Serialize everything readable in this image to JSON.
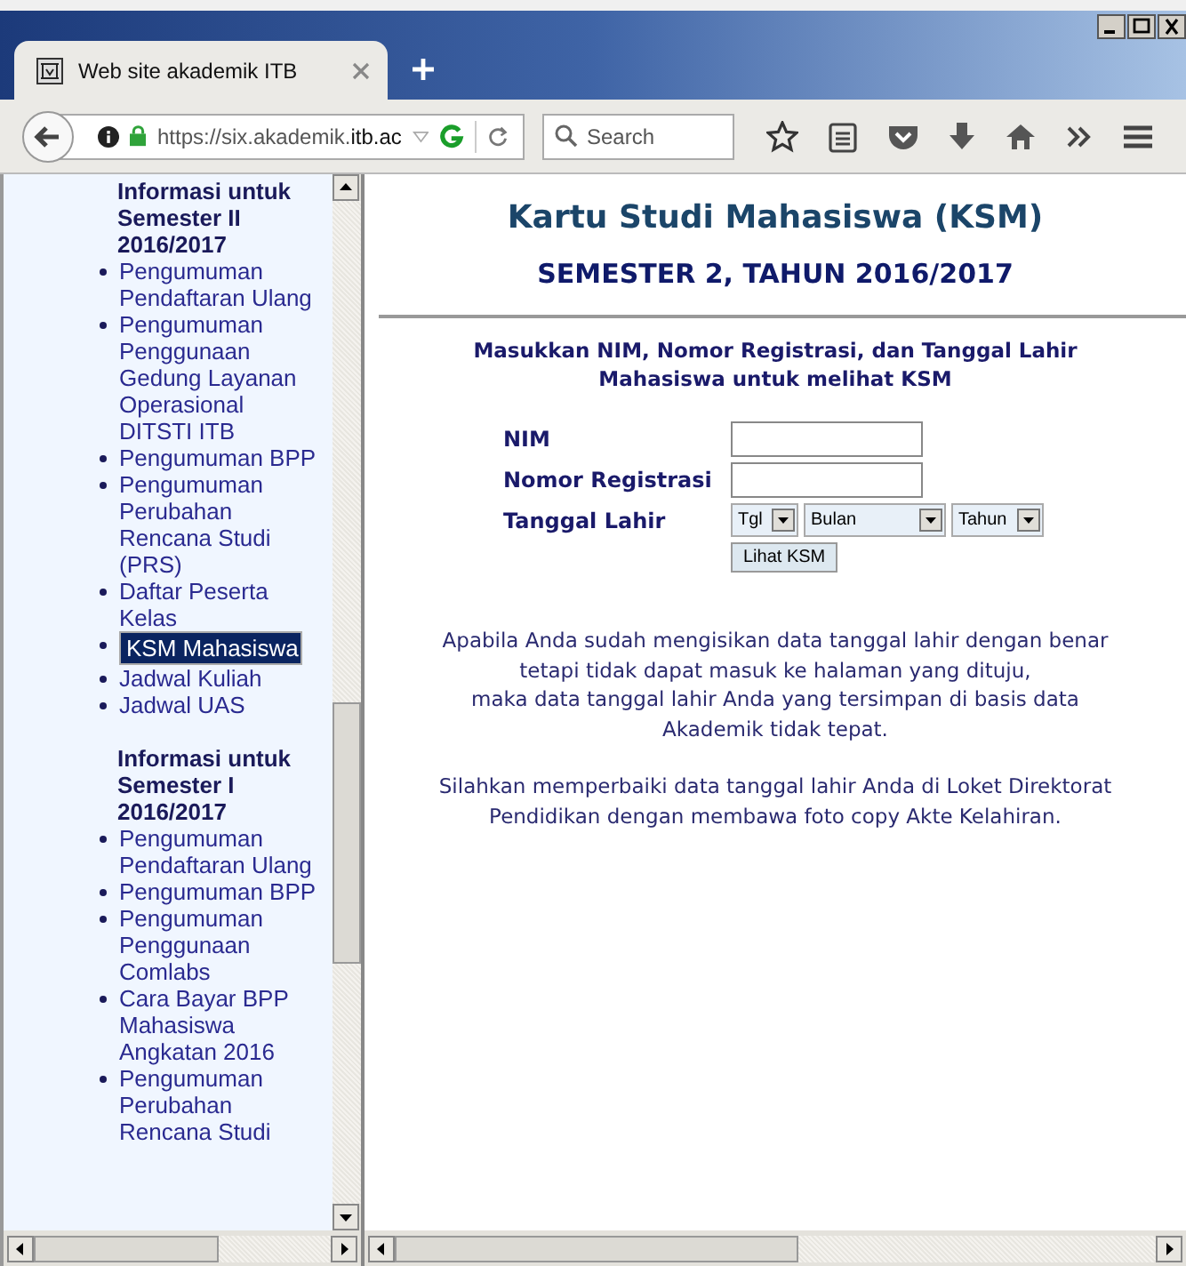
{
  "window": {
    "tab_title": "Web site akademik ITB",
    "address": "https://six.akademik.**itb.ac**",
    "search_placeholder": "Search"
  },
  "sidebar": {
    "sections": [
      {
        "heading": "Informasi untuk Semester II 2016/2017",
        "items": [
          {
            "label": "Pengumuman Pendaftaran Ulang",
            "selected": false
          },
          {
            "label": "Pengumuman Penggunaan Gedung Layanan Operasional DITSTI ITB",
            "selected": false
          },
          {
            "label": "Pengumuman BPP",
            "selected": false
          },
          {
            "label": "Pengumuman Perubahan Rencana Studi (PRS)",
            "selected": false
          },
          {
            "label": "Daftar Peserta Kelas",
            "selected": false
          },
          {
            "label": "KSM Mahasiswa",
            "selected": true
          },
          {
            "label": "Jadwal Kuliah",
            "selected": false
          },
          {
            "label": "Jadwal UAS",
            "selected": false
          }
        ]
      },
      {
        "heading": "Informasi untuk Semester I 2016/2017",
        "items": [
          {
            "label": "Pengumuman Pendaftaran Ulang",
            "selected": false
          },
          {
            "label": "Pengumuman BPP",
            "selected": false
          },
          {
            "label": "Pengumuman Penggunaan Comlabs",
            "selected": false
          },
          {
            "label": "Cara Bayar BPP Mahasiswa Angkatan 2016",
            "selected": false
          },
          {
            "label": "Pengumuman Perubahan Rencana Studi",
            "selected": false
          }
        ]
      }
    ]
  },
  "main": {
    "title": "Kartu Studi Mahasiswa (KSM)",
    "subtitle": "SEMESTER 2, TAHUN 2016/2017",
    "instruction": "Masukkan NIM, Nomor Registrasi, dan Tanggal Lahir\nMahasiswa untuk melihat KSM",
    "fields": [
      {
        "label": "NIM",
        "kind": "text"
      },
      {
        "label": "Nomor Registrasi",
        "kind": "text"
      },
      {
        "label": "Tanggal Lahir",
        "kind": "date",
        "selects": [
          "Tgl",
          "Bulan",
          "Tahun"
        ]
      }
    ],
    "button": "Lihat KSM",
    "notes": [
      "Apabila Anda sudah mengisikan data tanggal lahir dengan benar\ntetapi tidak dapat masuk ke halaman yang dituju,\nmaka data tanggal lahir Anda yang tersimpan di basis data\nAkademik tidak tepat.",
      "Silahkan memperbaiki data tanggal lahir Anda di Loket Direktorat\nPendidikan dengan membawa foto copy Akte Kelahiran."
    ]
  }
}
